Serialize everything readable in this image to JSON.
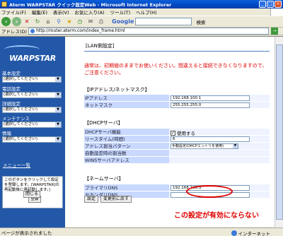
{
  "window": {
    "title": "Aterm WARPSTAR クイック設定Web - Microsoft Internet Explorer",
    "menus": [
      "ファイル(F)",
      "編集(E)",
      "表示(V)",
      "お気に入り(A)",
      "ツール(T)",
      "ヘルプ(H)"
    ]
  },
  "toolbar": {
    "google_label": "Google",
    "search_label": "検索"
  },
  "address": {
    "label": "アドレス(D)",
    "url": "http://router.aterm.com/index_frame.html",
    "go": "→"
  },
  "sidebar": {
    "logo": "WARPSTAR",
    "groups": [
      {
        "label": "基本設定",
        "value": "(選択してください)"
      },
      {
        "label": "電話設定",
        "value": "(選択してください)"
      },
      {
        "label": "詳細設定",
        "value": "(選択してください)"
      },
      {
        "label": "メンテナンス",
        "value": "(選択してください)"
      },
      {
        "label": "情報",
        "value": "(選択してください)"
      }
    ],
    "menu_list": "メニュー一覧",
    "note": "このボタンをクリックして設定を登録します。[WARPSTAR]の再起動後に再起動します。]",
    "register_button": "登録",
    "close_button": "閉じる"
  },
  "main": {
    "page_title": "[LAN側設定]",
    "warning": "通常は、初期値のままでお使いください。間違えると接続できなくなりますので、ご注意ください。",
    "sections": {
      "ip": {
        "title": "【IPアドレス/ネットマスク】",
        "rows": [
          {
            "label": "IPアドレス",
            "value": "192.168.100.1"
          },
          {
            "label": "ネットマスク",
            "value": "255.255.255.0"
          }
        ]
      },
      "dhcp": {
        "title": "【DHCPサーバ】",
        "function_label": "DHCPサーバ機能",
        "function_value": "使用する",
        "lease_label": "リースタイム(時間)",
        "lease_value": "6",
        "pattern_label": "アドレス割当パターン",
        "pattern_value": "手動設定(DHCPエントリを使用)",
        "auto_label": "自動設定時の割当数",
        "wins_label": "WINSサーバアドレス"
      },
      "dns": {
        "title": "【ネームサーバ】",
        "primary_label": "プライマリDNS",
        "primary_value": "192.168.100.3",
        "secondary_label": "セカンダリDNS",
        "secondary_value": ""
      }
    },
    "buttons": {
      "set": "設定",
      "undo": "変更前に戻す"
    }
  },
  "annotation": {
    "text": "この設定が有効にならない",
    "color": "#e00000"
  },
  "statusbar": {
    "text": "ページが表示されました",
    "zone": "インターネット"
  },
  "colors": {
    "sidebar_bg": "#2358A8",
    "label_bg": "#c8d8ff",
    "value_bg": "#eef3ff",
    "warning": "#e00000"
  }
}
